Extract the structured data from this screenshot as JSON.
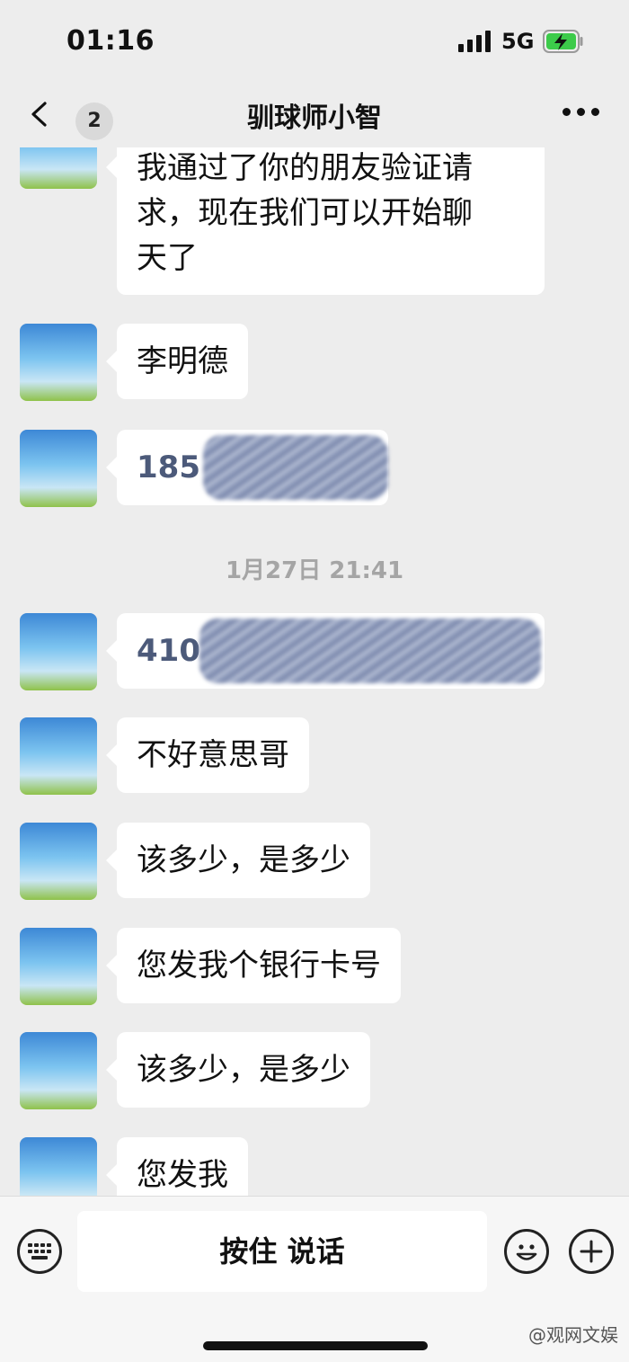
{
  "status_bar": {
    "time": "01:16",
    "network": "5G",
    "signal_icon": "signal-bars-icon",
    "battery_icon": "battery-charging-icon"
  },
  "header": {
    "back_icon": "chevron-left-icon",
    "unread_count": "2",
    "title": "驯球师小智",
    "more_icon": "more-dots-icon"
  },
  "messages": [
    {
      "type": "text",
      "lines": [
        "我通过了你的朋友验证请",
        "求，现在我们可以开始聊",
        "天了"
      ]
    },
    {
      "type": "text",
      "text": "李明德"
    },
    {
      "type": "redacted",
      "visible_prefix": "185"
    },
    {
      "type": "timestamp",
      "text": "1月27日 21:41"
    },
    {
      "type": "redacted",
      "visible_prefix": "410"
    },
    {
      "type": "text",
      "text": "不好意思哥"
    },
    {
      "type": "text",
      "text": "该多少，是多少"
    },
    {
      "type": "text",
      "text": "您发我个银行卡号"
    },
    {
      "type": "text",
      "text": "该多少，是多少"
    },
    {
      "type": "text",
      "text": "您发我"
    }
  ],
  "input_bar": {
    "keyboard_icon": "keyboard-icon",
    "hold_to_talk_label": "按住 说话",
    "emoji_icon": "emoji-icon",
    "plus_icon": "plus-icon"
  },
  "watermark": "@观网文娱",
  "colors": {
    "background": "#ededed",
    "bubble": "#ffffff",
    "redacted_number": "#4c5a7a",
    "timestamp": "#a5a5a5"
  }
}
